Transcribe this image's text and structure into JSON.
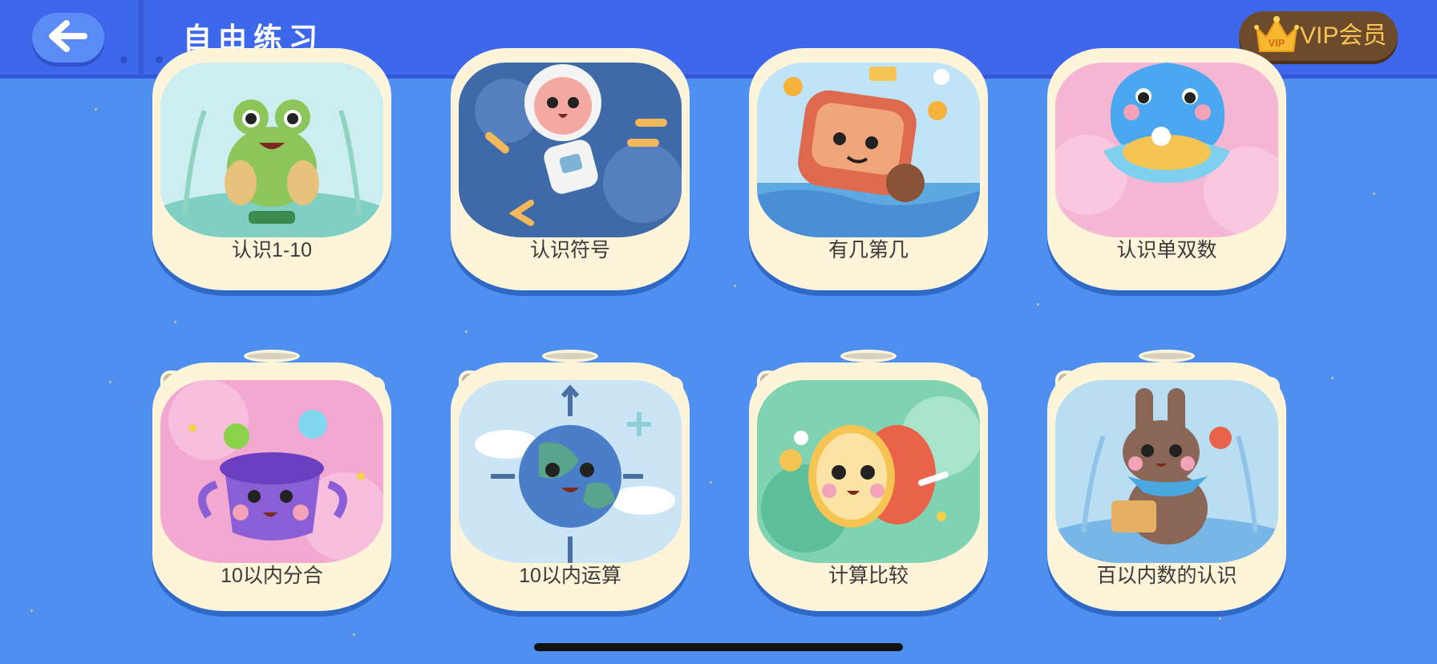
{
  "header": {
    "back_icon": "arrow-left-icon",
    "title": "自由练习",
    "vip_label": "VIP会员",
    "vip_badge": "VIP",
    "vip_icon": "crown-icon"
  },
  "colors": {
    "background": "#4f8ff0",
    "header": "#3e68ec",
    "card": "#fdf4d9",
    "vip_text": "#f6c453"
  },
  "lessons": [
    {
      "label": "认识1-10",
      "icon": "frog-icon"
    },
    {
      "label": "认识符号",
      "icon": "astronaut-icon"
    },
    {
      "label": "有几第几",
      "icon": "robot-train-icon"
    },
    {
      "label": "认识单双数",
      "icon": "pearl-shell-icon"
    },
    {
      "label": "10以内分合",
      "icon": "cauldron-icon"
    },
    {
      "label": "10以内运算",
      "icon": "earth-icon"
    },
    {
      "label": "计算比较",
      "icon": "drum-icon"
    },
    {
      "label": "百以内数的认识",
      "icon": "rabbit-icon"
    }
  ]
}
